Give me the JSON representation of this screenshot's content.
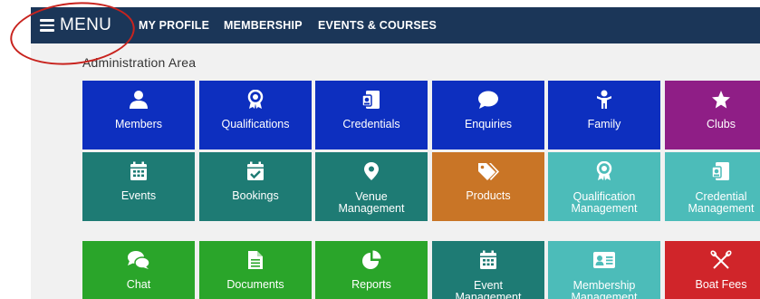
{
  "header": {
    "menu_label": "MENU",
    "nav": [
      "MY PROFILE",
      "MEMBERSHIP",
      "EVENTS & COURSES"
    ]
  },
  "section_title": "Administration Area",
  "colors": {
    "header": "#1b3658",
    "annotation_ring": "#c8231e",
    "blue": "#0d2fbf",
    "purple": "#8f1e86",
    "teal": "#1e7b74",
    "orange": "#c97526",
    "light_teal": "#4cbcb9",
    "green": "#2aa52a",
    "red": "#d0252a"
  },
  "tiles": [
    {
      "label": "Members",
      "icon": "person-icon",
      "color": "blue"
    },
    {
      "label": "Qualifications",
      "icon": "award-icon",
      "color": "blue"
    },
    {
      "label": "Credentials",
      "icon": "id-card-icon",
      "color": "blue"
    },
    {
      "label": "Enquiries",
      "icon": "chat-bubble-icon",
      "color": "blue"
    },
    {
      "label": "Family",
      "icon": "child-icon",
      "color": "blue"
    },
    {
      "label": "Clubs",
      "icon": "star-icon",
      "color": "purple"
    },
    {
      "label": "Events",
      "icon": "calendar-icon",
      "color": "teal"
    },
    {
      "label": "Bookings",
      "icon": "calendar-check-icon",
      "color": "teal"
    },
    {
      "label": "Venue Management",
      "icon": "map-pin-icon",
      "color": "teal"
    },
    {
      "label": "Products",
      "icon": "tags-icon",
      "color": "orange"
    },
    {
      "label": "Qualification Management",
      "icon": "award-icon",
      "color": "light_teal"
    },
    {
      "label": "Credential Management",
      "icon": "id-card-icon",
      "color": "light_teal"
    },
    {
      "label": "Chat",
      "icon": "chat-icon",
      "color": "green"
    },
    {
      "label": "Documents",
      "icon": "document-icon",
      "color": "green"
    },
    {
      "label": "Reports",
      "icon": "pie-chart-icon",
      "color": "green"
    },
    {
      "label": "Event Management",
      "icon": "calendar-icon",
      "color": "teal"
    },
    {
      "label": "Membership Management",
      "icon": "address-card-icon",
      "color": "light_teal"
    },
    {
      "label": "Boat Fees",
      "icon": "crossed-oars-icon",
      "color": "red"
    }
  ]
}
